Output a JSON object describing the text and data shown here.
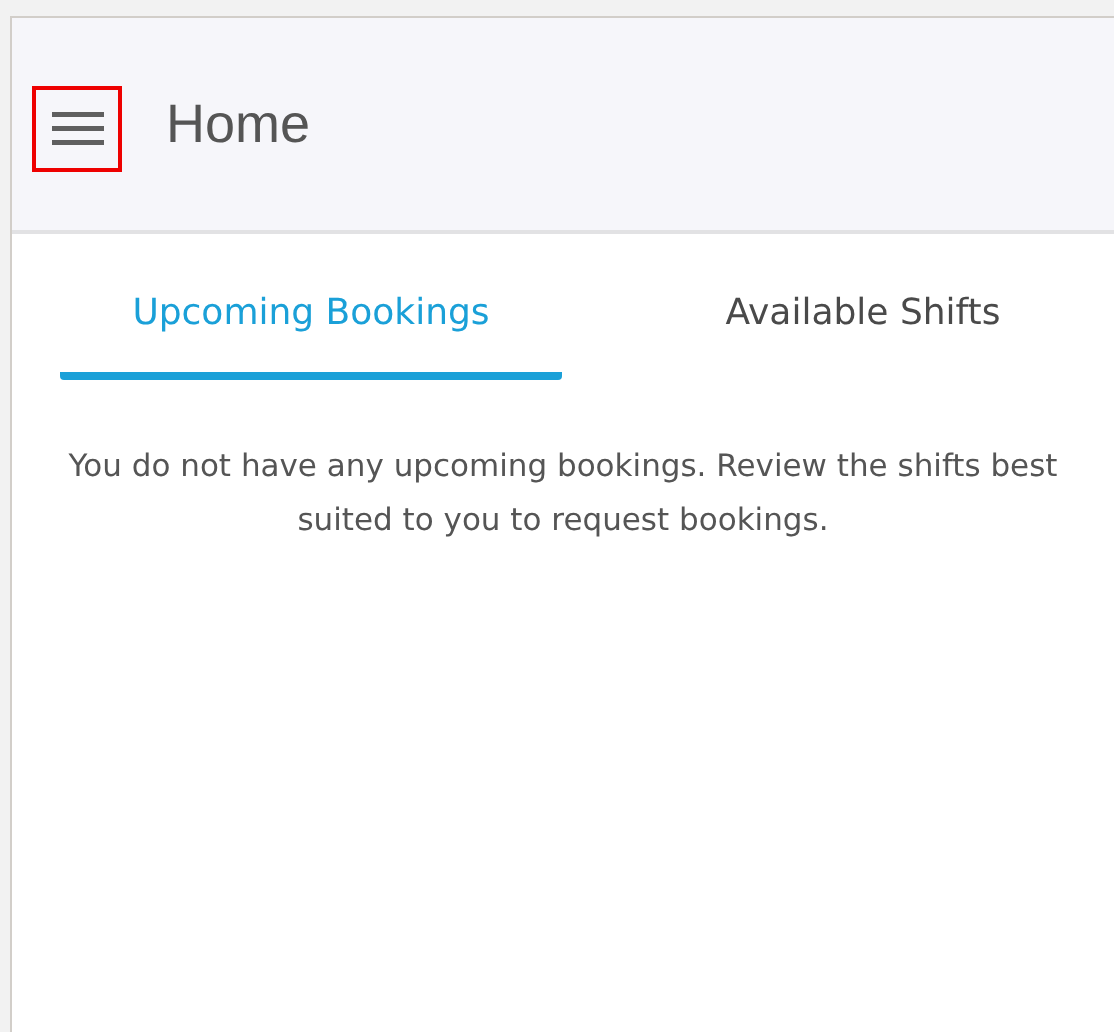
{
  "header": {
    "menu_button": {
      "highlighted": true
    },
    "title": "Home"
  },
  "tabs": [
    {
      "label": "Upcoming Bookings",
      "selected": true
    },
    {
      "label": "Available Shifts",
      "selected": false
    }
  ],
  "message": "You do not have any upcoming bookings. Review the shifts best suited to you to request bookings."
}
